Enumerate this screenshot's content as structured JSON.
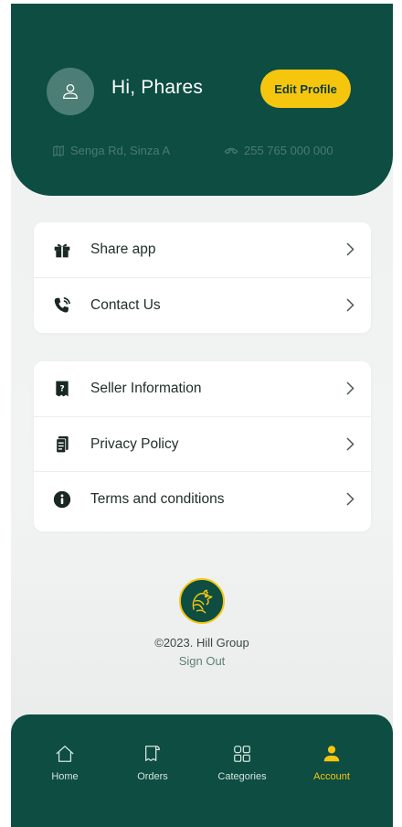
{
  "header": {
    "greeting": "Hi, Phares",
    "edit_profile_label": "Edit Profile",
    "address": "Senga Rd, Sinza A",
    "phone": "255 765 000 000"
  },
  "menu_group_1": [
    {
      "label": "Share app",
      "icon": "gift-icon"
    },
    {
      "label": "Contact Us",
      "icon": "phone-ringing-icon"
    }
  ],
  "menu_group_2": [
    {
      "label": "Seller Information",
      "icon": "receipt-question-icon"
    },
    {
      "label": "Privacy Policy",
      "icon": "document-icon"
    },
    {
      "label": "Terms and conditions",
      "icon": "info-icon"
    }
  ],
  "footer": {
    "copyright": "©2023. Hill Group",
    "sign_out": "Sign Out"
  },
  "bottom_nav": [
    {
      "label": "Home",
      "icon": "home-icon"
    },
    {
      "label": "Orders",
      "icon": "receipt-icon"
    },
    {
      "label": "Categories",
      "icon": "grid-icon"
    },
    {
      "label": "Account",
      "icon": "user-icon",
      "active": true
    }
  ],
  "colors": {
    "primary": "#0d4d42",
    "accent": "#f6c60f",
    "background": "#eef1f0"
  }
}
